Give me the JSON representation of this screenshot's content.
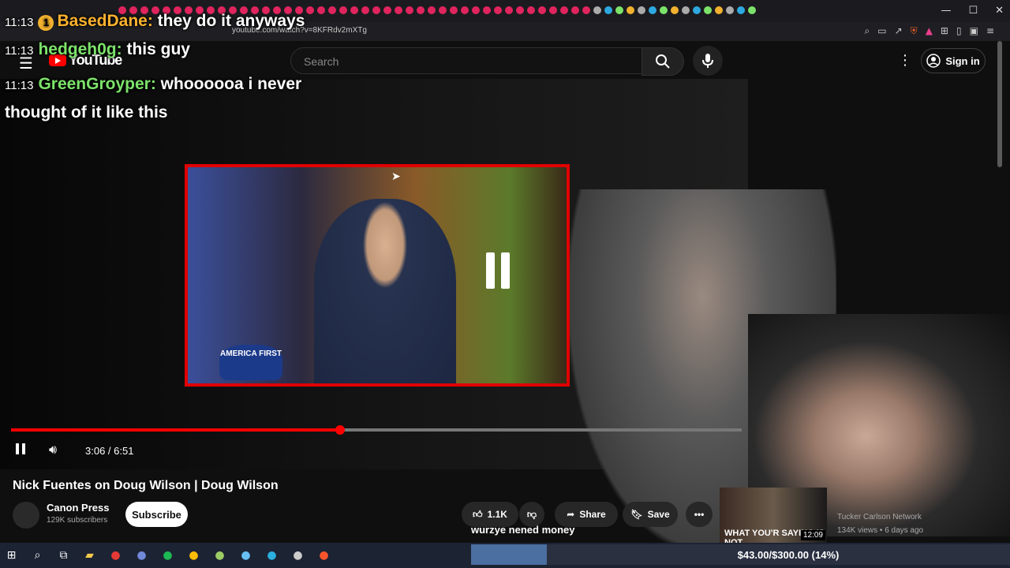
{
  "browser": {
    "url": "youtube.com/watch?v=8KFRdv2mXTg"
  },
  "youtube": {
    "logo_text": "YouTube",
    "search_placeholder": "Search",
    "signin_label": "Sign in"
  },
  "chat": [
    {
      "time": "11:13",
      "user": "BasedDane:",
      "message": "they do it anyways",
      "badge": "1"
    },
    {
      "time": "11:13",
      "user": "hedgeh0g:",
      "message": "this guy"
    },
    {
      "time": "11:13",
      "user": "GreenGroyper:",
      "message": "whoooooa i never thought of it like this"
    }
  ],
  "player": {
    "time": "3:06 / 6:51",
    "progress_fraction": 0.45,
    "hat_text": "AMERICA FIRST"
  },
  "video": {
    "title": "Nick Fuentes on Doug Wilson | Doug Wilson",
    "channel": "Canon Press",
    "subscribers": "129K subscribers",
    "subscribe_label": "Subscribe",
    "likes": "1.1K",
    "share_label": "Share",
    "save_label": "Save"
  },
  "caption": "wurzye nened money",
  "recommended": {
    "thumb_text": "WHAT YOU'R SAYING IS NOT",
    "duration": "12:09",
    "channel": "Tucker Carlson Network",
    "meta": "134K views • 6 days ago"
  },
  "donation_goal": {
    "text": "$43.00/$300.00 (14%)",
    "fraction": 0.14
  },
  "colors": {
    "accent": "#ff0000",
    "chat_user_gold": "#ffb22e",
    "chat_user_green": "#7ce36a"
  }
}
